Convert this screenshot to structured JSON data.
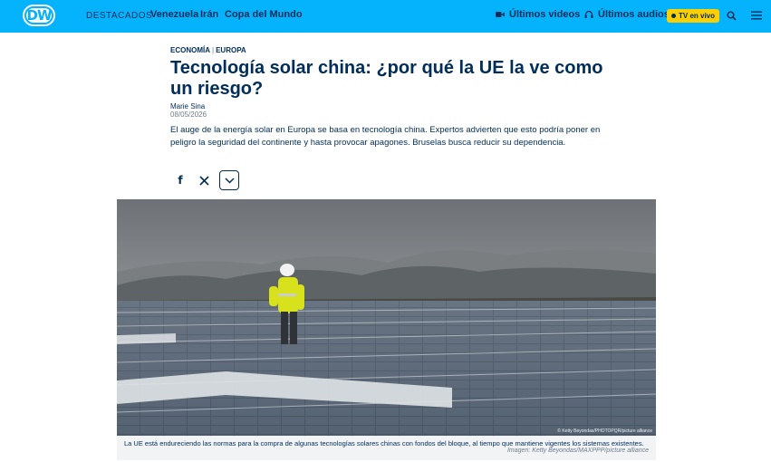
{
  "header": {
    "logo_text": "DW",
    "featured_label": "DESTACADOS",
    "nav_links": [
      "Venezuela",
      "Irán",
      "Copa del Mundo"
    ],
    "latest_videos": "Últimos videos",
    "latest_audios": "Últimos audios",
    "live_tv": "TV en vivo",
    "icons": [
      "video-camera-icon",
      "headphones-icon",
      "search-icon",
      "menu-icon"
    ]
  },
  "article": {
    "category": "ECONOMÍA",
    "region": "EUROPA",
    "title": "Tecnología solar china: ¿por qué la UE la ve como un riesgo?",
    "author": "Marie Sina",
    "date": "08/05/2026",
    "teaser": "El auge de la energía solar en Europa se basa en tecnología china. Expertos advierten que esto podría poner en peligro la seguridad del continente y hasta provocar apagones. Bruselas busca reducir su dependencia.",
    "share": {
      "facebook_glyph": "f",
      "x_glyph": "𝕏"
    }
  },
  "image": {
    "overlay_credit": "© Ketty Beyondas/PHOTOPQR/picture alliance",
    "caption": "La UE está endureciendo las normas para la compra de algunas tecnologías solares chinas con fondos del bloque, al tiempo que mantiene vigentes los sistemas existentes.",
    "credit": "Imagen: Ketty Beyondas/MAXPPP/picture alliance"
  },
  "colors": {
    "brand_blue": "#05b2fc",
    "dark_navy": "#002d5a",
    "live_yellow": "#fcd000"
  }
}
